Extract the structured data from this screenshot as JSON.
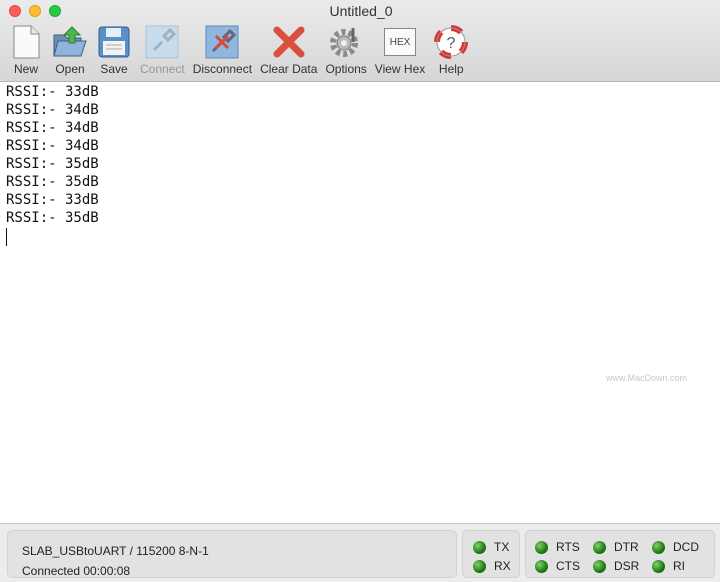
{
  "window": {
    "title": "Untitled_0"
  },
  "toolbar": [
    {
      "label": "New",
      "icon": "new-document-icon",
      "enabled": true
    },
    {
      "label": "Open",
      "icon": "open-folder-icon",
      "enabled": true
    },
    {
      "label": "Save",
      "icon": "save-disk-icon",
      "enabled": true
    },
    {
      "label": "Connect",
      "icon": "connect-plug-icon",
      "enabled": false
    },
    {
      "label": "Disconnect",
      "icon": "disconnect-plug-icon",
      "enabled": true
    },
    {
      "label": "Clear Data",
      "icon": "clear-x-icon",
      "enabled": true
    },
    {
      "label": "Options",
      "icon": "gear-icon",
      "enabled": true
    },
    {
      "label": "View Hex",
      "icon": "hex-icon",
      "icon_text": "HEX",
      "enabled": true
    },
    {
      "label": "Help",
      "icon": "lifebuoy-help-icon",
      "enabled": true
    }
  ],
  "console": {
    "lines": [
      "RSSI:- 33dB",
      "RSSI:- 34dB",
      "RSSI:- 34dB",
      "RSSI:- 34dB",
      "RSSI:- 35dB",
      "RSSI:- 35dB",
      "RSSI:- 33dB",
      "RSSI:- 35dB"
    ]
  },
  "status": {
    "port": "SLAB_USBtoUART / 115200 8-N-1",
    "connection": "Connected 00:00:08",
    "leds": [
      {
        "label": "TX",
        "on": true
      },
      {
        "label": "RX",
        "on": true
      },
      {
        "label": "RTS",
        "on": true
      },
      {
        "label": "CTS",
        "on": true
      },
      {
        "label": "DTR",
        "on": true
      },
      {
        "label": "DSR",
        "on": true
      },
      {
        "label": "DCD",
        "on": true
      },
      {
        "label": "RI",
        "on": true
      }
    ],
    "led_color": "#2a8a1a"
  },
  "watermark": {
    "text": "www.MacDown.com"
  }
}
